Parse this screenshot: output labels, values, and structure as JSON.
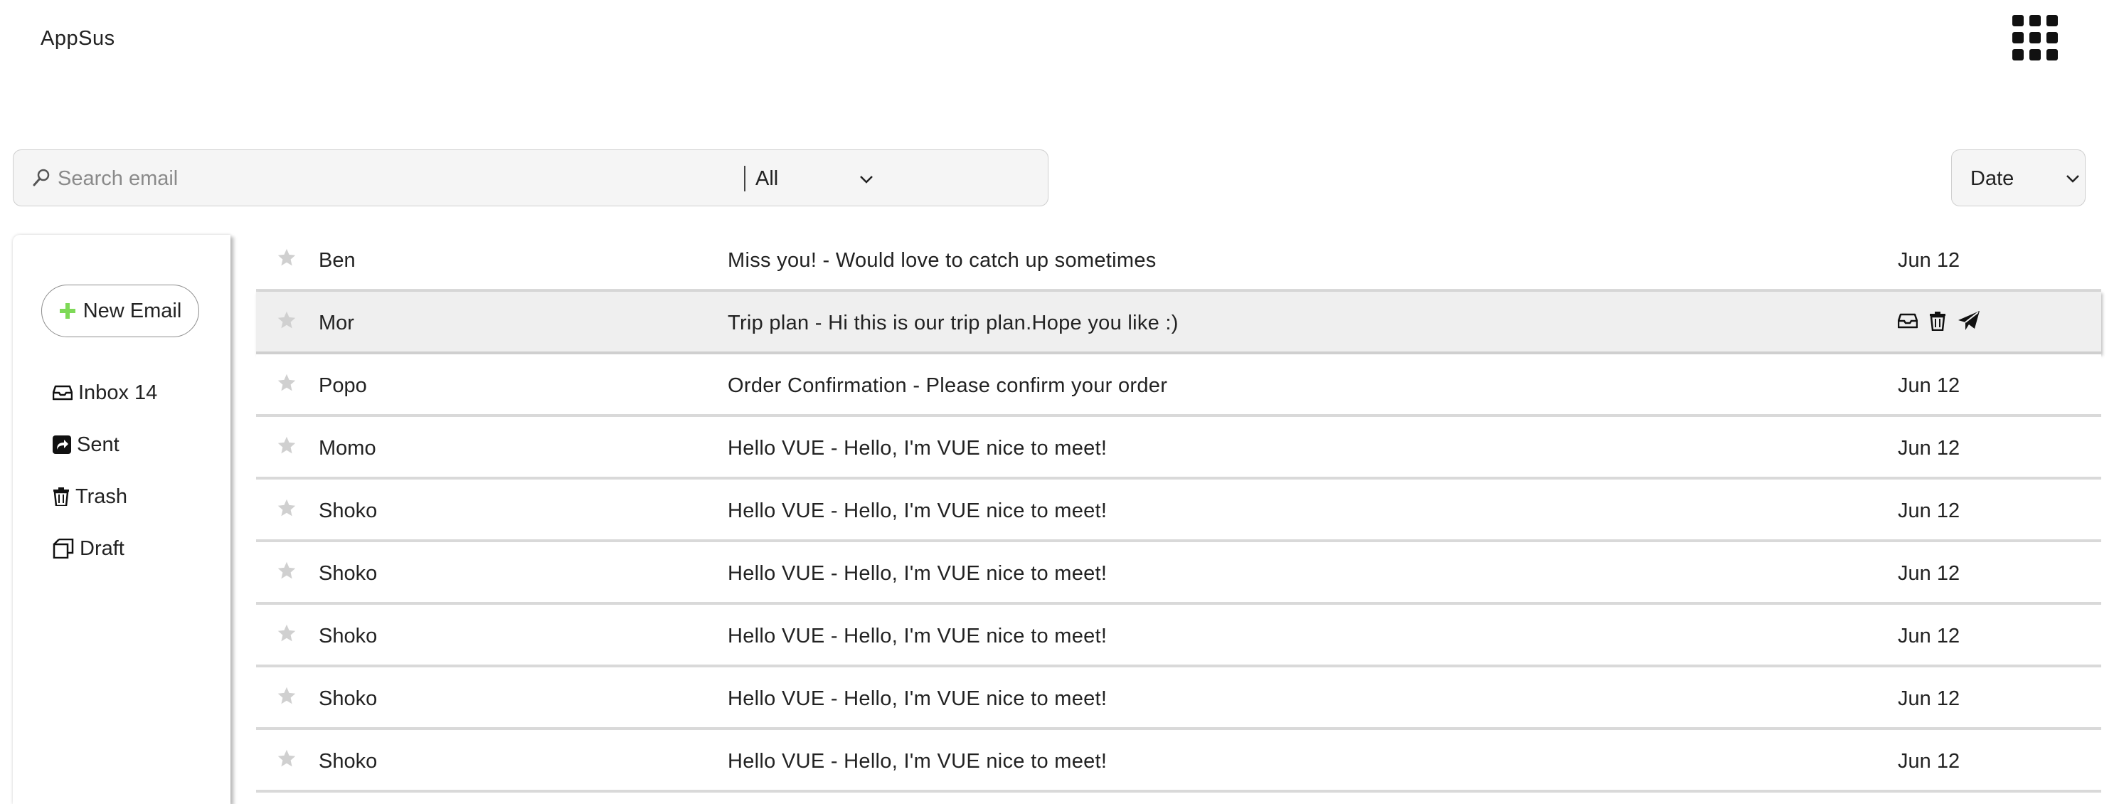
{
  "app": {
    "title": "AppSus"
  },
  "header": {
    "apps_icon": "apps-grid-icon"
  },
  "search": {
    "placeholder": "Search email",
    "value": "",
    "icon": "search-icon",
    "filter_selected": "All",
    "sort_selected": "Date"
  },
  "sidebar": {
    "new_email_label": "New Email",
    "items": [
      {
        "label": "Inbox 14",
        "icon": "inbox-icon"
      },
      {
        "label": "Sent",
        "icon": "sent-icon"
      },
      {
        "label": "Trash",
        "icon": "trash-icon"
      },
      {
        "label": "Draft",
        "icon": "draft-icon"
      }
    ]
  },
  "emails": [
    {
      "sender": "Ben",
      "subject": "Miss you! - Would love to catch up sometimes",
      "date": "Jun 12"
    },
    {
      "sender": "Mor",
      "subject": "Trip plan - Hi this is our trip plan.Hope you like :)",
      "date": ""
    },
    {
      "sender": "Popo",
      "subject": "Order Confirmation - Please confirm your order",
      "date": "Jun 12"
    },
    {
      "sender": "Momo",
      "subject": "Hello VUE - Hello, I'm VUE nice to meet!",
      "date": "Jun 12"
    },
    {
      "sender": "Shoko",
      "subject": "Hello VUE - Hello, I'm VUE nice to meet!",
      "date": "Jun 12"
    },
    {
      "sender": "Shoko",
      "subject": "Hello VUE - Hello, I'm VUE nice to meet!",
      "date": "Jun 12"
    },
    {
      "sender": "Shoko",
      "subject": "Hello VUE - Hello, I'm VUE nice to meet!",
      "date": "Jun 12"
    },
    {
      "sender": "Shoko",
      "subject": "Hello VUE - Hello, I'm VUE nice to meet!",
      "date": "Jun 12"
    },
    {
      "sender": "Shoko",
      "subject": "Hello VUE - Hello, I'm VUE nice to meet!",
      "date": "Jun 12"
    }
  ],
  "colors": {
    "accent_plus": "#7ed957",
    "star_inactive": "#d0d0d0",
    "hover_row": "#efefef"
  }
}
